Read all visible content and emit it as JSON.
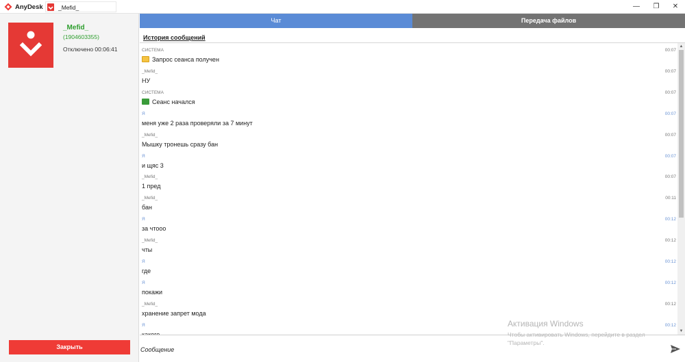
{
  "titlebar": {
    "app_name": "AnyDesk",
    "tab_label": "_Mefid_",
    "minimize": "—",
    "restore": "❐",
    "close": "✕"
  },
  "peer": {
    "name": "_Mefid_",
    "id": "(1904603355)",
    "status": "Отключено 00:06:41",
    "close_button": "Закрыть"
  },
  "tabs": {
    "chat": "Чат",
    "files": "Передача файлов"
  },
  "history_title": "История сообщений",
  "messages": [
    {
      "sender": "СИСТЕМА",
      "time": "00:07",
      "text": "Запрос сеанса получен",
      "icon": "book-icon",
      "me": false
    },
    {
      "sender": "_Mefid_",
      "time": "00:07",
      "text": "НУ",
      "me": false
    },
    {
      "sender": "СИСТЕМА",
      "time": "00:07",
      "text": "Сеанс начался",
      "icon": "screen-icon",
      "me": false
    },
    {
      "sender": "Я",
      "time": "00:07",
      "text": "меня уже 2 раза проверяли за 7 минут",
      "me": true
    },
    {
      "sender": "_Mefid_",
      "time": "00:07",
      "text": "Мышку тронешь сразу бан",
      "me": false
    },
    {
      "sender": "Я",
      "time": "00:07",
      "text": "и щяс 3",
      "me": true
    },
    {
      "sender": "_Mefid_",
      "time": "00:07",
      "text": "1 пред",
      "me": false
    },
    {
      "sender": "_Mefid_",
      "time": "00:11",
      "text": "бан",
      "me": false
    },
    {
      "sender": "Я",
      "time": "00:12",
      "text": "за чтооо",
      "me": true
    },
    {
      "sender": "_Mefid_",
      "time": "00:12",
      "text": "чты",
      "me": false
    },
    {
      "sender": "Я",
      "time": "00:12",
      "text": "где",
      "me": true
    },
    {
      "sender": "Я",
      "time": "00:12",
      "text": "покажи",
      "me": true
    },
    {
      "sender": "_Mefid_",
      "time": "00:12",
      "text": "хранение запрет мода",
      "me": false
    },
    {
      "sender": "Я",
      "time": "00:12",
      "text": "какого",
      "me": true
    }
  ],
  "input": {
    "placeholder": "Сообщение"
  },
  "watermark": {
    "title": "Активация Windows",
    "subtitle": "Чтобы активировать Windows, перейдите в раздел \"Параметры\"."
  },
  "colors": {
    "accent_red": "#e53935",
    "chat_tab": "#5a8bd6",
    "files_tab": "#737373",
    "peer_green": "#2e9e2e",
    "me_blue": "#6a93d4"
  }
}
